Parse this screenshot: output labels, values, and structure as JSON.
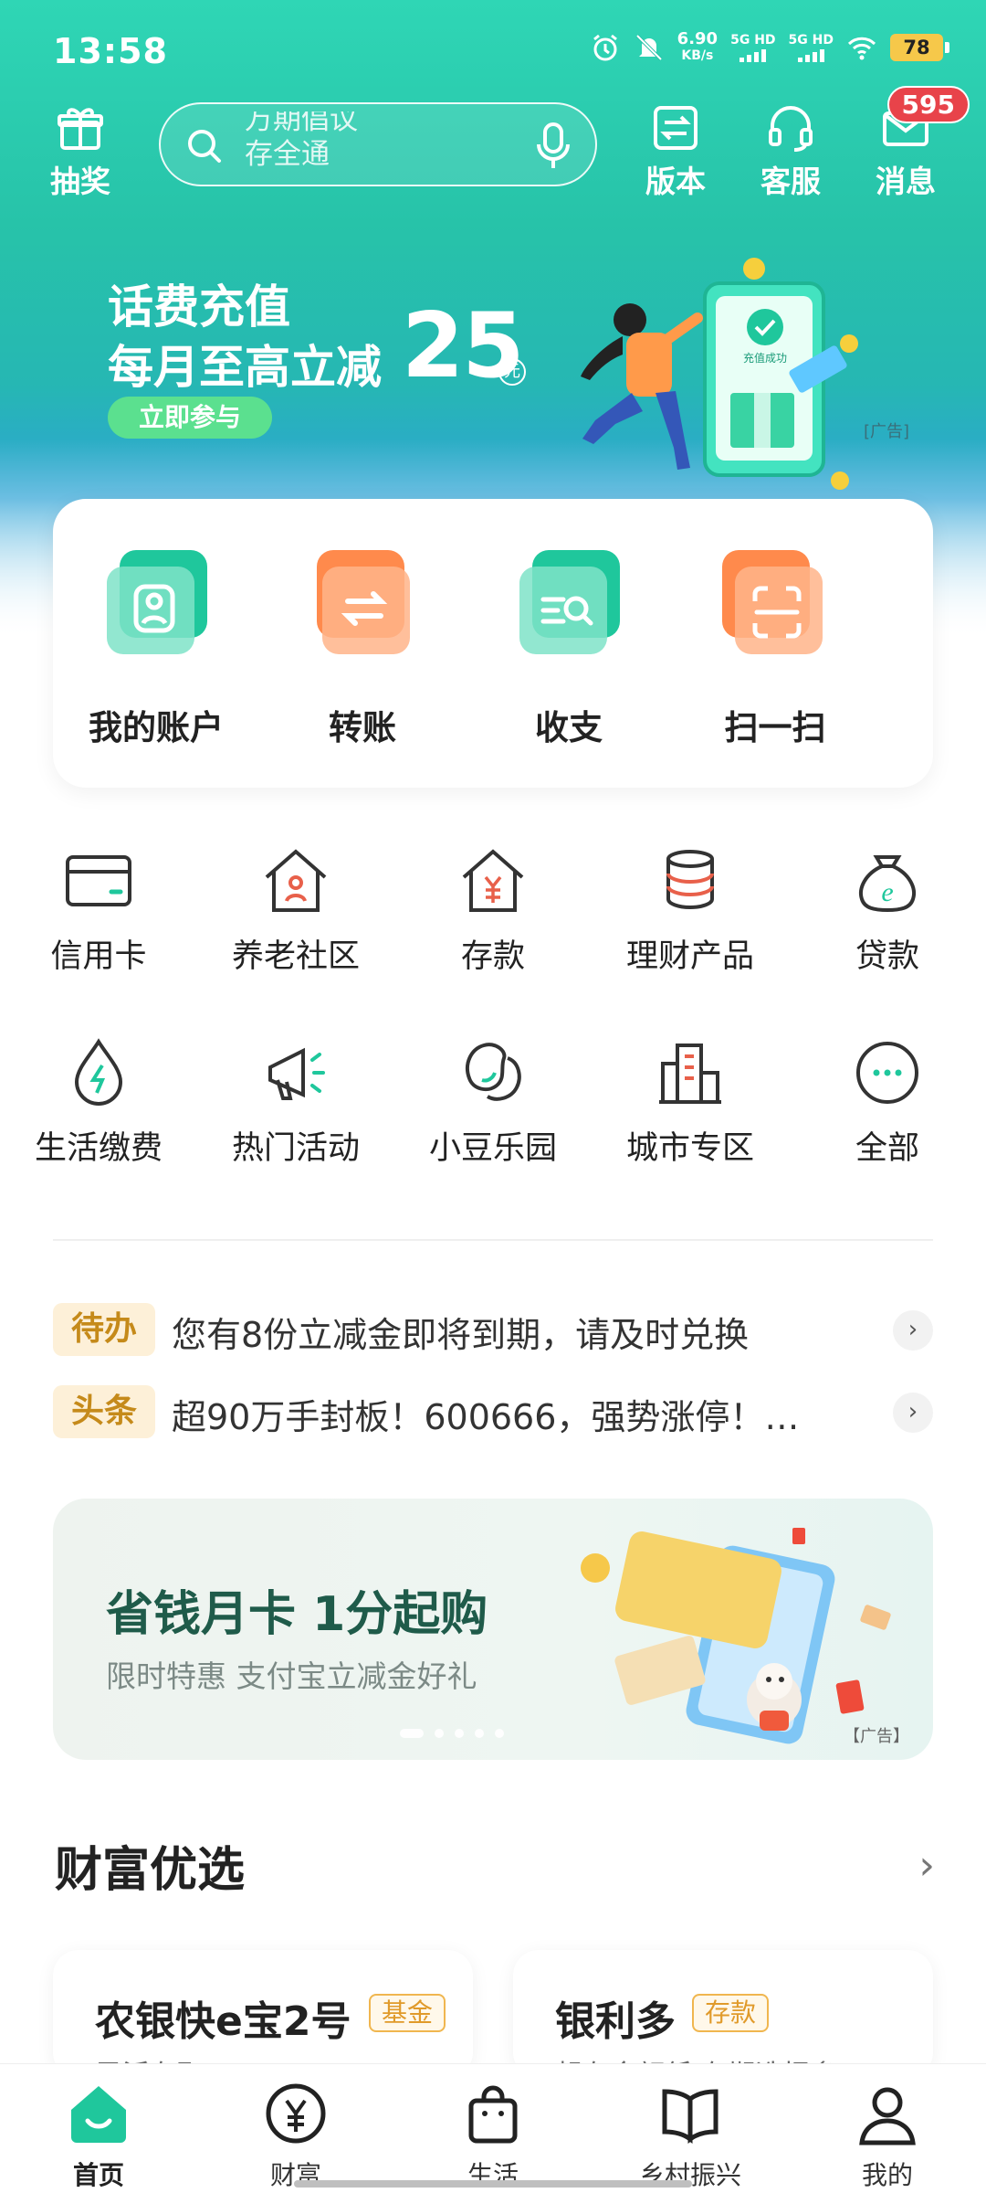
{
  "status_bar": {
    "time": "13:58",
    "net_speed_value": "6.90",
    "net_speed_unit": "KB/s",
    "sim1": "5G HD",
    "sim2": "5G HD",
    "battery": "78"
  },
  "top_bar": {
    "lottery_label": "抽奖",
    "search_lines": [
      "万期倡议",
      "存全通"
    ],
    "version_label": "版本",
    "service_label": "客服",
    "messages_label": "消息",
    "messages_badge": "595"
  },
  "banner": {
    "line1": "话费充值",
    "line2": "每月至高立减",
    "amount": "25",
    "unit": "元",
    "cta": "立即参与",
    "ad_tag": "[广告]",
    "success_text": "充值成功"
  },
  "quick_actions": [
    {
      "label": "我的账户",
      "icon": "account-icon"
    },
    {
      "label": "转账",
      "icon": "transfer-icon"
    },
    {
      "label": "收支",
      "icon": "income-expense-icon"
    },
    {
      "label": "扫一扫",
      "icon": "scan-icon"
    }
  ],
  "menu_row1": [
    {
      "label": "信用卡",
      "icon": "credit-card-icon"
    },
    {
      "label": "养老社区",
      "icon": "elderly-community-icon"
    },
    {
      "label": "存款",
      "icon": "deposit-icon"
    },
    {
      "label": "理财产品",
      "icon": "wealth-products-icon"
    },
    {
      "label": "贷款",
      "icon": "loan-icon"
    }
  ],
  "menu_row2": [
    {
      "label": "生活缴费",
      "icon": "utility-payment-icon"
    },
    {
      "label": "热门活动",
      "icon": "hot-activity-icon"
    },
    {
      "label": "小豆乐园",
      "icon": "bean-park-icon"
    },
    {
      "label": "城市专区",
      "icon": "city-zone-icon"
    },
    {
      "label": "全部",
      "icon": "more-icon"
    }
  ],
  "notices": [
    {
      "tag": "待办",
      "text": "您有8份立减金即将到期，请及时兑换"
    },
    {
      "tag": "头条",
      "text": "超90万手封板！600666，强势涨停！…"
    }
  ],
  "promo": {
    "title": "省钱月卡 1分起购",
    "subtitle": "限时特惠 支付宝立减金好礼",
    "ad_tag": "【广告】",
    "carousel_active_index": 0,
    "carousel_count": 5
  },
  "wealth_section": {
    "title": "财富优选",
    "cards": [
      {
        "name": "农银快e宝2号",
        "badge": "基金",
        "sub": "灵活存取"
      },
      {
        "name": "银利多",
        "badge": "存款",
        "sub": "起存金额低 存期选择多"
      }
    ]
  },
  "bottom_nav": [
    {
      "label": "首页",
      "icon": "home-icon",
      "active": true
    },
    {
      "label": "财富",
      "icon": "wealth-icon",
      "active": false
    },
    {
      "label": "生活",
      "icon": "shopping-bag-icon",
      "active": false
    },
    {
      "label": "乡村振兴",
      "icon": "book-icon",
      "active": false
    },
    {
      "label": "我的",
      "icon": "profile-icon",
      "active": false
    }
  ],
  "colors": {
    "brand_green": "#1fc79c",
    "hero_gradient_top": "#2fd6b5",
    "hero_gradient_bottom": "#2ea3d6",
    "badge_red": "#e8434a",
    "quick_green": "#2cc79a",
    "quick_orange": "#ff8a4c",
    "tag_gold": "#c58a1a"
  }
}
